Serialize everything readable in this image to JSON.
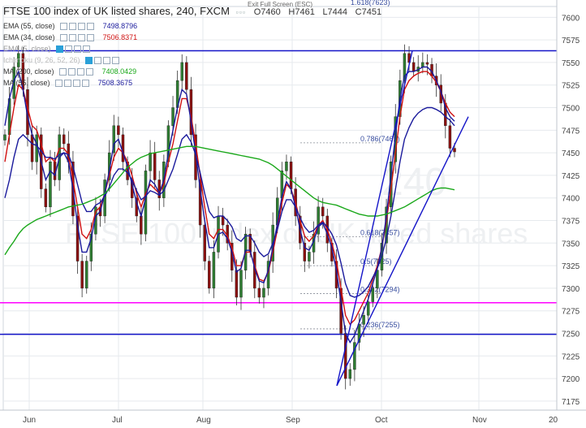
{
  "header": {
    "title": "FTSE 100 index of UK listed shares, 240, FXCM",
    "open": "O7460",
    "high": "H7461",
    "low": "L7444",
    "close": "C7451"
  },
  "exit_full_screen": "Exit Full Screen (ESC)",
  "watermark": "FTSE 100 index of UK listed shares",
  "watermark_num": "240",
  "indicators": [
    {
      "label": "EMA (55, close)",
      "value": "7498.8796",
      "color": "#1a1a9c"
    },
    {
      "label": "EMA (34, close)",
      "value": "7506.8371",
      "color": "#d01010"
    },
    {
      "label": "EMA (5, close)",
      "value": "",
      "color": "#888888"
    },
    {
      "label": "Ichimoku (9, 26, 52, 26)",
      "value": "",
      "color": "#888888"
    },
    {
      "label": "MA (200, close)",
      "value": "7408.0429",
      "color": "#1aa81a"
    },
    {
      "label": "MA (55, close)",
      "value": "7508.3675",
      "color": "#1a1a9c"
    }
  ],
  "chart_data": {
    "type": "candlestick",
    "title": "FTSE 100 index of UK listed shares, 240, FXCM",
    "x_ticks": [
      "Jun",
      "Jul",
      "Aug",
      "Sep",
      "Oct",
      "Nov",
      "20"
    ],
    "y_ticks": [
      7175,
      7200,
      7225,
      7250,
      7275,
      7300,
      7325,
      7350,
      7375,
      7400,
      7425,
      7450,
      7475,
      7500,
      7525,
      7550,
      7575,
      7600
    ],
    "ylim": [
      7165,
      7612
    ],
    "grid": true,
    "last_price": "7451",
    "horizontal_levels": [
      {
        "value": 7563,
        "label": "7563",
        "color": "#1414c8"
      },
      {
        "value": 7284,
        "label": "7284",
        "color": "#ff00ff"
      },
      {
        "value": 7249,
        "label": "7249",
        "color": "#1414c8"
      }
    ],
    "fib_levels": [
      {
        "label": "1.618(7623)",
        "value": 7623
      },
      {
        "label": "0.786(7461)",
        "value": 7461
      },
      {
        "label": "0.618(7357)",
        "value": 7357
      },
      {
        "label": "0.5(7325)",
        "value": 7325
      },
      {
        "label": "0.382(7294)",
        "value": 7294
      },
      {
        "label": "0.236(7255)",
        "value": 7255
      }
    ],
    "price_path": [
      7470,
      7510,
      7545,
      7560,
      7520,
      7470,
      7440,
      7470,
      7410,
      7390,
      7440,
      7420,
      7470,
      7460,
      7440,
      7380,
      7330,
      7300,
      7330,
      7360,
      7390,
      7380,
      7420,
      7450,
      7480,
      7470,
      7440,
      7420,
      7400,
      7380,
      7360,
      7430,
      7450,
      7420,
      7400,
      7440,
      7480,
      7500,
      7530,
      7550,
      7520,
      7470,
      7420,
      7370,
      7330,
      7300,
      7340,
      7380,
      7370,
      7350,
      7320,
      7290,
      7320,
      7360,
      7340,
      7300,
      7290,
      7300,
      7330,
      7370,
      7400,
      7430,
      7440,
      7410,
      7380,
      7350,
      7330,
      7340,
      7360,
      7390,
      7380,
      7350,
      7330,
      7300,
      7250,
      7200,
      7210,
      7240,
      7260,
      7270,
      7285,
      7300,
      7320,
      7350,
      7390,
      7440,
      7490,
      7530,
      7560,
      7550,
      7540,
      7545,
      7550,
      7548,
      7535,
      7525,
      7505,
      7480,
      7455,
      7451
    ],
    "series": [
      {
        "name": "EMA (34, close)",
        "color": "#d01010",
        "values": [
          7440,
          7470,
          7500,
          7525,
          7520,
          7500,
          7480,
          7475,
          7460,
          7440,
          7445,
          7440,
          7455,
          7455,
          7448,
          7420,
          7390,
          7360,
          7355,
          7365,
          7385,
          7390,
          7405,
          7425,
          7445,
          7455,
          7450,
          7440,
          7425,
          7405,
          7390,
          7405,
          7415,
          7410,
          7405,
          7415,
          7440,
          7460,
          7485,
          7510,
          7510,
          7490,
          7460,
          7425,
          7390,
          7360,
          7355,
          7365,
          7365,
          7358,
          7345,
          7325,
          7325,
          7340,
          7340,
          7325,
          7310,
          7308,
          7318,
          7340,
          7365,
          7395,
          7415,
          7410,
          7395,
          7375,
          7358,
          7352,
          7358,
          7370,
          7375,
          7365,
          7350,
          7330,
          7300,
          7270,
          7260,
          7265,
          7275,
          7285,
          7295,
          7310,
          7325,
          7345,
          7375,
          7410,
          7450,
          7490,
          7520,
          7530,
          7535,
          7538,
          7540,
          7540,
          7535,
          7528,
          7518,
          7505,
          7495,
          7490
        ]
      },
      {
        "name": "EMA (55, close)",
        "color": "#1a1a9c",
        "values": [
          7400,
          7420,
          7445,
          7465,
          7470,
          7465,
          7460,
          7458,
          7452,
          7445,
          7445,
          7443,
          7448,
          7450,
          7448,
          7435,
          7415,
          7395,
          7385,
          7385,
          7392,
          7395,
          7402,
          7412,
          7425,
          7432,
          7432,
          7428,
          7420,
          7408,
          7398,
          7402,
          7408,
          7406,
          7403,
          7408,
          7420,
          7432,
          7448,
          7465,
          7470,
          7462,
          7448,
          7428,
          7405,
          7385,
          7378,
          7380,
          7380,
          7375,
          7368,
          7355,
          7352,
          7358,
          7358,
          7350,
          7340,
          7335,
          7338,
          7350,
          7365,
          7385,
          7398,
          7398,
          7390,
          7378,
          7368,
          7362,
          7364,
          7370,
          7373,
          7368,
          7360,
          7348,
          7328,
          7305,
          7292,
          7290,
          7292,
          7296,
          7302,
          7312,
          7322,
          7336,
          7355,
          7380,
          7410,
          7440,
          7465,
          7478,
          7488,
          7494,
          7498,
          7500,
          7500,
          7498,
          7495,
          7490,
          7486,
          7480
        ]
      },
      {
        "name": "MA (55, close)",
        "color": "#1a1a9c",
        "values": [
          7480,
          7510,
          7530,
          7540,
          7520,
          7490,
          7470,
          7460,
          7440,
          7420,
          7430,
          7425,
          7445,
          7450,
          7440,
          7410,
          7370,
          7340,
          7340,
          7355,
          7380,
          7385,
          7405,
          7430,
          7460,
          7465,
          7450,
          7435,
          7415,
          7395,
          7380,
          7400,
          7420,
          7415,
          7405,
          7420,
          7450,
          7475,
          7500,
          7520,
          7515,
          7485,
          7450,
          7410,
          7375,
          7345,
          7345,
          7360,
          7362,
          7355,
          7340,
          7318,
          7322,
          7342,
          7342,
          7322,
          7308,
          7306,
          7320,
          7345,
          7372,
          7402,
          7418,
          7410,
          7390,
          7365,
          7345,
          7342,
          7352,
          7368,
          7372,
          7360,
          7345,
          7320,
          7285,
          7250,
          7240,
          7248,
          7262,
          7275,
          7288,
          7305,
          7322,
          7345,
          7380,
          7425,
          7470,
          7510,
          7535,
          7540,
          7540,
          7542,
          7545,
          7545,
          7540,
          7530,
          7518,
          7500,
          7490,
          7485
        ]
      },
      {
        "name": "MA (200, close)",
        "color": "#1aa81a",
        "values": [
          7337,
          7345,
          7352,
          7360,
          7366,
          7370,
          7373,
          7376,
          7378,
          7380,
          7382,
          7384,
          7386,
          7388,
          7390,
          7391,
          7392,
          7393,
          7395,
          7397,
          7399,
          7402,
          7405,
          7410,
          7416,
          7422,
          7428,
          7434,
          7438,
          7442,
          7445,
          7447,
          7449,
          7450,
          7451,
          7452,
          7453,
          7454,
          7455,
          7456,
          7457,
          7457,
          7457,
          7456,
          7455,
          7454,
          7453,
          7452,
          7451,
          7450,
          7449,
          7448,
          7447,
          7446,
          7445,
          7444,
          7443,
          7441,
          7439,
          7436,
          7432,
          7428,
          7424,
          7420,
          7416,
          7412,
          7408,
          7404,
          7400,
          7397,
          7395,
          7394,
          7393,
          7392,
          7390,
          7388,
          7386,
          7384,
          7382,
          7381,
          7380,
          7380,
          7380,
          7381,
          7382,
          7384,
          7386,
          7388,
          7390,
          7393,
          7396,
          7399,
          7402,
          7405,
          7408,
          7410,
          7411,
          7411,
          7410,
          7409
        ]
      }
    ]
  }
}
